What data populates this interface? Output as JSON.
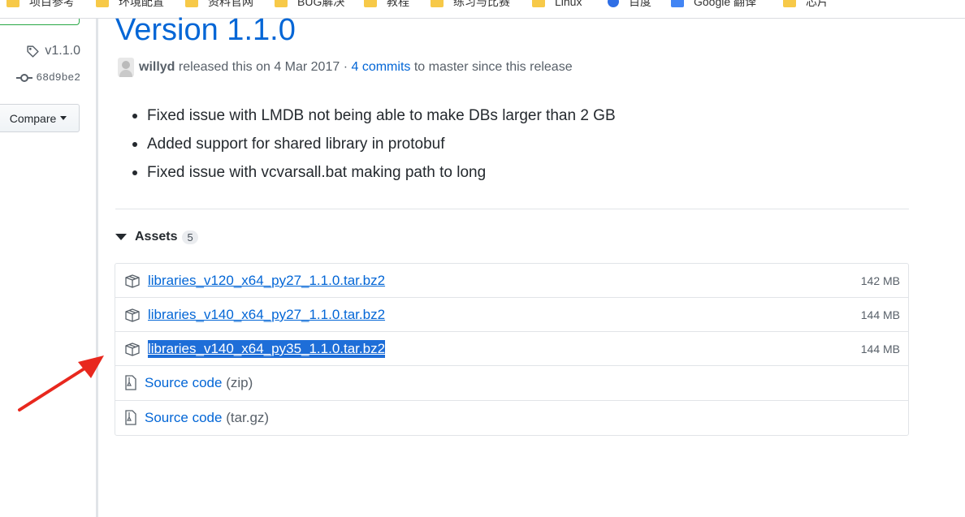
{
  "bookmarks": [
    {
      "label": "项目参考",
      "icon": "folder-icon"
    },
    {
      "label": "环境配置",
      "icon": "folder-icon"
    },
    {
      "label": "资料官网",
      "icon": "folder-icon"
    },
    {
      "label": "BUG解决",
      "icon": "folder-icon"
    },
    {
      "label": "教程",
      "icon": "folder-icon"
    },
    {
      "label": "练习与比赛",
      "icon": "folder-icon"
    },
    {
      "label": "Linux",
      "icon": "folder-icon"
    },
    {
      "label": "百度",
      "icon": "baidu-icon"
    },
    {
      "label": "Google 翻译",
      "icon": "translate-icon"
    },
    {
      "label": "芯片",
      "icon": "folder-icon"
    }
  ],
  "sidebar": {
    "tag": "v1.1.0",
    "commit": "68d9be2",
    "compare_label": "Compare"
  },
  "release": {
    "title": "Version 1.1.0",
    "author": "willyd",
    "released_text": "released this on 4 Mar 2017",
    "separator": "·",
    "commits_link": "4 commits",
    "commits_suffix": "to master since this release"
  },
  "notes": [
    "Fixed issue with LMDB not being able to make DBs larger than 2 GB",
    "Added support for shared library in protobuf",
    "Fixed issue with vcvarsall.bat making path to long"
  ],
  "assets": {
    "label": "Assets",
    "count": "5",
    "files": [
      {
        "name": "libraries_v120_x64_py27_1.1.0.tar.bz2",
        "size": "142 MB",
        "selected": false
      },
      {
        "name": "libraries_v140_x64_py27_1.1.0.tar.bz2",
        "size": "144 MB",
        "selected": false
      },
      {
        "name": "libraries_v140_x64_py35_1.1.0.tar.bz2",
        "size": "144 MB",
        "selected": true
      }
    ],
    "source": [
      {
        "label": "Source code",
        "format": "(zip)"
      },
      {
        "label": "Source code",
        "format": "(tar.gz)"
      }
    ]
  },
  "colors": {
    "link": "#0366d6",
    "selection": "#1e6ed8",
    "annotation_arrow": "#e8281e"
  }
}
